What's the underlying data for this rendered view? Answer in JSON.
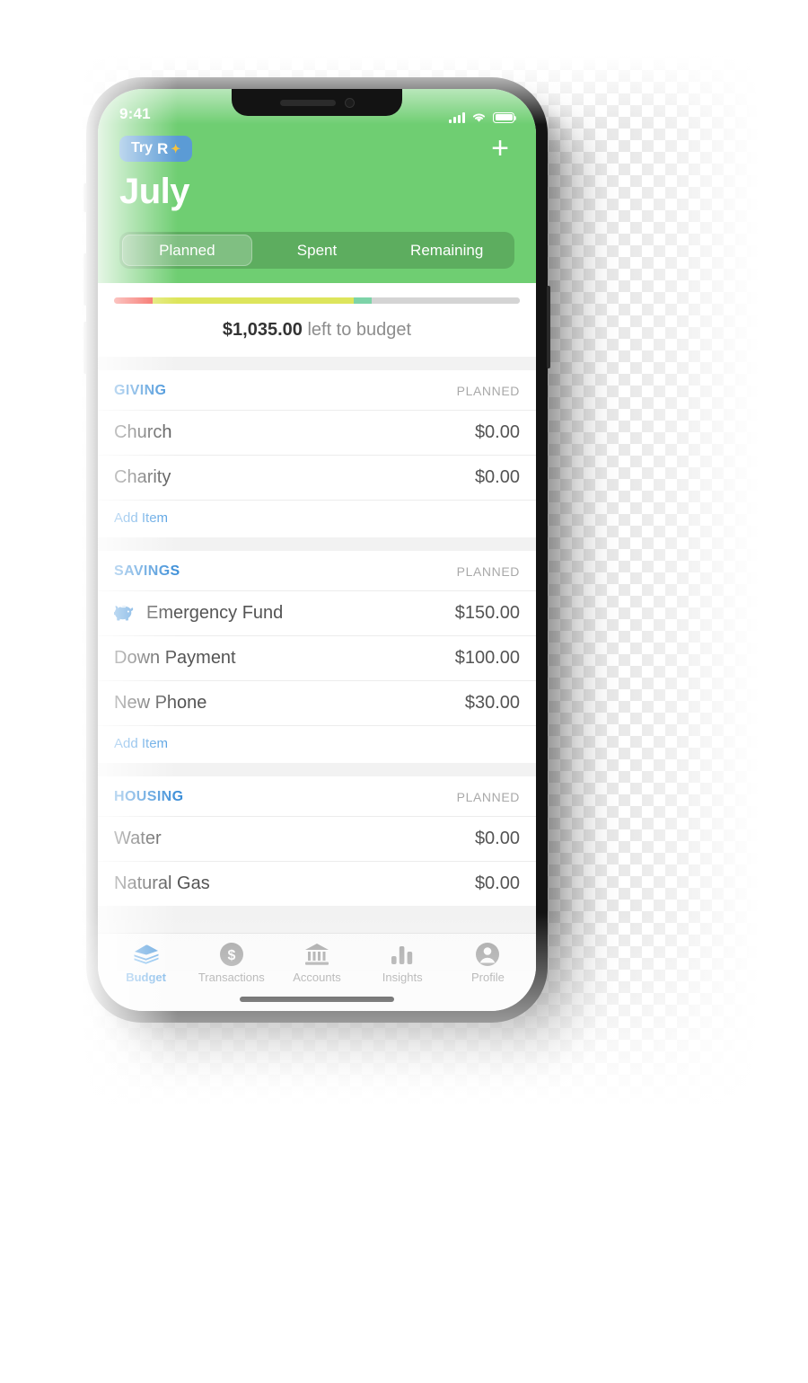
{
  "status_bar": {
    "time": "9:41",
    "signal_icon": "cellular-signal-icon",
    "wifi_icon": "wifi-icon",
    "battery_icon": "battery-icon"
  },
  "header": {
    "try_badge": {
      "label": "Try",
      "brand": "R",
      "sparkle": "✦"
    },
    "add_button_icon": "plus-icon",
    "month_title": "July",
    "background_color": "#6fce72",
    "segments": [
      {
        "label": "Planned",
        "active": true
      },
      {
        "label": "Spent",
        "active": false
      },
      {
        "label": "Remaining",
        "active": false
      }
    ]
  },
  "summary": {
    "amount": "$1,035.00",
    "caption": " left to budget",
    "progress": [
      {
        "color": "#f4534a",
        "pct": 9.5
      },
      {
        "color": "#dde55c",
        "pct": 49.5
      },
      {
        "color": "#7dd3a8",
        "pct": 4.5
      },
      {
        "color": "#d4d4d4",
        "pct": 36.5
      }
    ]
  },
  "sections": [
    {
      "title": "GIVING",
      "column": "PLANNED",
      "items": [
        {
          "name": "Church",
          "amount": "$0.00",
          "icon": null
        },
        {
          "name": "Charity",
          "amount": "$0.00",
          "icon": null
        }
      ],
      "add_label": "Add Item"
    },
    {
      "title": "SAVINGS",
      "column": "PLANNED",
      "items": [
        {
          "name": "Emergency Fund",
          "amount": "$150.00",
          "icon": "piggy-bank-icon"
        },
        {
          "name": "Down Payment",
          "amount": "$100.00",
          "icon": null
        },
        {
          "name": "New Phone",
          "amount": "$30.00",
          "icon": null
        }
      ],
      "add_label": "Add Item"
    },
    {
      "title": "HOUSING",
      "column": "PLANNED",
      "items": [
        {
          "name": "Water",
          "amount": "$0.00",
          "icon": null
        },
        {
          "name": "Natural Gas",
          "amount": "$0.00",
          "icon": null
        }
      ],
      "add_label": null
    }
  ],
  "tab_bar": {
    "accent_color": "#4a9ae0",
    "inactive_color": "#9a9a9a",
    "tabs": [
      {
        "label": "Budget",
        "icon": "money-stack-icon",
        "active": true
      },
      {
        "label": "Transactions",
        "icon": "dollar-circle-icon",
        "active": false
      },
      {
        "label": "Accounts",
        "icon": "bank-icon",
        "active": false
      },
      {
        "label": "Insights",
        "icon": "bar-chart-icon",
        "active": false
      },
      {
        "label": "Profile",
        "icon": "person-circle-icon",
        "active": false
      }
    ]
  }
}
